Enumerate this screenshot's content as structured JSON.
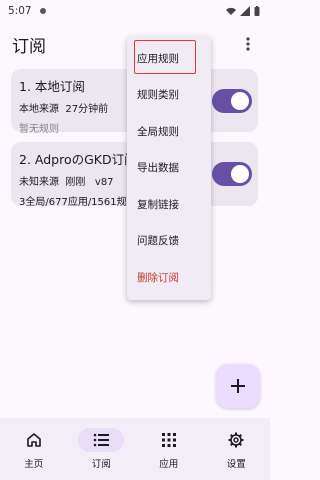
{
  "status_bar": {
    "time": "5:07"
  },
  "app_bar": {
    "title": "订阅"
  },
  "subscriptions": [
    {
      "title": "1. 本地订阅",
      "source": "本地来源",
      "updated": "27分钟前",
      "version": "",
      "summary": "暂无规则",
      "enabled": true
    },
    {
      "title": "2. AdproのGKD订阅",
      "source": "未知来源",
      "updated": "刚刚",
      "version": "v87",
      "summary": "3全局/677应用/1561规则组",
      "enabled": true
    }
  ],
  "menu": {
    "items": [
      {
        "label": "应用规则"
      },
      {
        "label": "规则类别"
      },
      {
        "label": "全局规则"
      },
      {
        "label": "导出数据"
      },
      {
        "label": "复制链接"
      },
      {
        "label": "问题反馈"
      },
      {
        "label": "删除订阅"
      }
    ]
  },
  "fab": {
    "icon": "plus-icon"
  },
  "bottom_nav": {
    "items": [
      {
        "label": "主页",
        "icon": "home-icon"
      },
      {
        "label": "订阅",
        "icon": "list-icon"
      },
      {
        "label": "应用",
        "icon": "apps-grid-icon"
      },
      {
        "label": "设置",
        "icon": "gear-icon"
      }
    ],
    "active_index": 1
  },
  "colors": {
    "accent": "#6750a4",
    "danger": "#c0392b",
    "highlight": "#e53935"
  }
}
